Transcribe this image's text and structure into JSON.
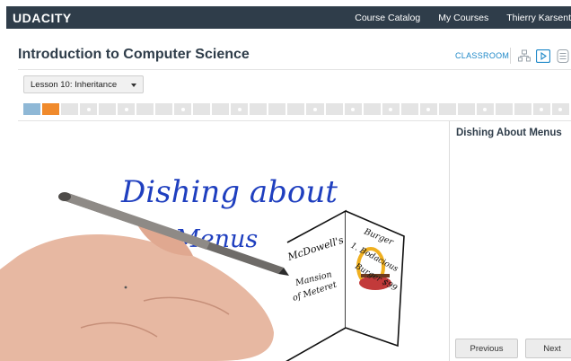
{
  "header": {
    "logo": "UDACITY",
    "nav": [
      "Course Catalog",
      "My Courses",
      "Thierry Karsent"
    ]
  },
  "course": {
    "title": "Introduction to Computer Science",
    "classroom_label": "CLASSROOM"
  },
  "lesson_select": {
    "selected": "Lesson 10: Inheritance"
  },
  "progress": {
    "segments": [
      {
        "state": "done",
        "dot": false
      },
      {
        "state": "current",
        "dot": false
      },
      {
        "state": "todo",
        "dot": false
      },
      {
        "state": "todo",
        "dot": true
      },
      {
        "state": "todo",
        "dot": false
      },
      {
        "state": "todo",
        "dot": true
      },
      {
        "state": "todo",
        "dot": false
      },
      {
        "state": "todo",
        "dot": false
      },
      {
        "state": "todo",
        "dot": true
      },
      {
        "state": "todo",
        "dot": false
      },
      {
        "state": "todo",
        "dot": false
      },
      {
        "state": "todo",
        "dot": true
      },
      {
        "state": "todo",
        "dot": false
      },
      {
        "state": "todo",
        "dot": false
      },
      {
        "state": "todo",
        "dot": false
      },
      {
        "state": "todo",
        "dot": true
      },
      {
        "state": "todo",
        "dot": false
      },
      {
        "state": "todo",
        "dot": true
      },
      {
        "state": "todo",
        "dot": false
      },
      {
        "state": "todo",
        "dot": true
      },
      {
        "state": "todo",
        "dot": false
      },
      {
        "state": "todo",
        "dot": true
      },
      {
        "state": "todo",
        "dot": false
      },
      {
        "state": "todo",
        "dot": false
      },
      {
        "state": "todo",
        "dot": true
      },
      {
        "state": "todo",
        "dot": false
      },
      {
        "state": "todo",
        "dot": false
      },
      {
        "state": "todo",
        "dot": true
      },
      {
        "state": "todo",
        "dot": true
      }
    ]
  },
  "video": {
    "whiteboard_text": [
      "Dishing about",
      "Menus"
    ],
    "menu_left": [
      "McDowell's",
      "Mansion",
      "of Meteret"
    ],
    "menu_right": [
      "Burger",
      "1. Bodacious",
      "Burger $99"
    ]
  },
  "sidebar": {
    "title": "Dishing About Menus",
    "prev_label": "Previous",
    "next_label": "Next"
  },
  "colors": {
    "nav_bg": "#2f3d4a",
    "accent": "#1e88c8",
    "progress_done": "#8fb8d6",
    "progress_current": "#f08a2c",
    "ink": "#1f3fbf"
  },
  "icons": [
    "tree-view-icon",
    "video-icon",
    "notes-icon",
    "chevron-down-icon"
  ]
}
